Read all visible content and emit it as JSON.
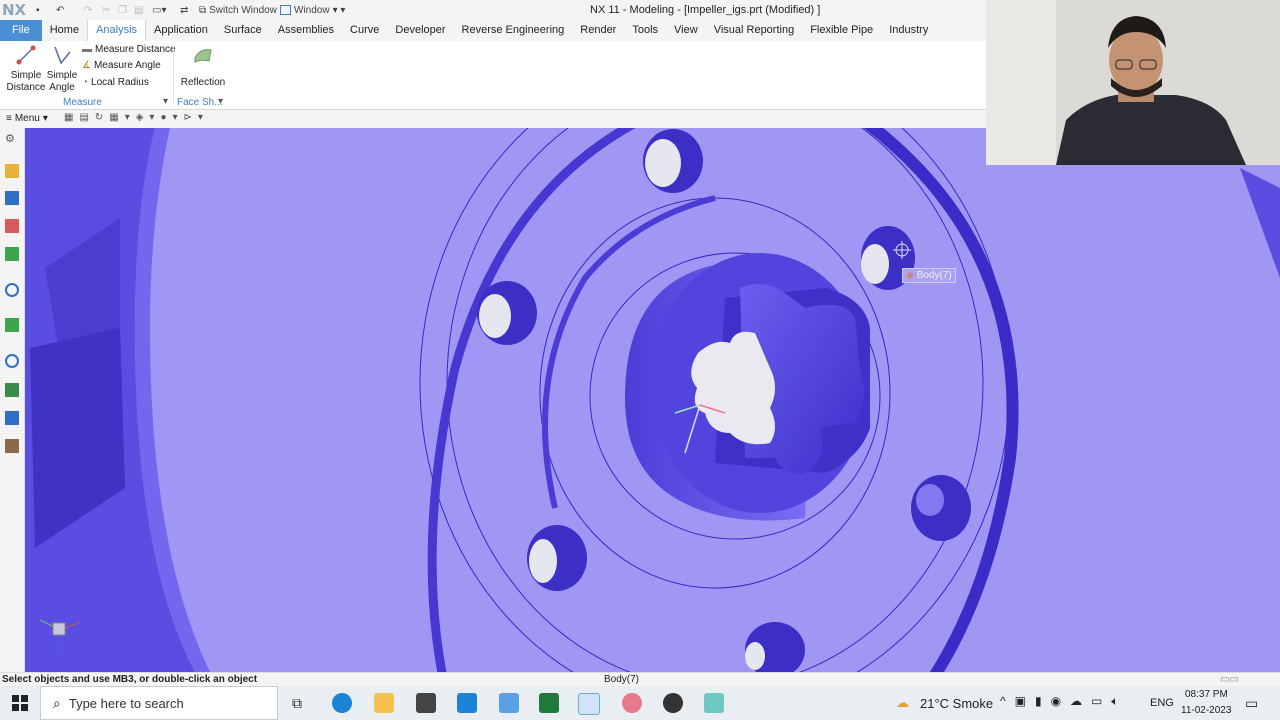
{
  "titlebar": {
    "logo": "NX",
    "switch_window": "Switch Window",
    "window": "Window",
    "title": "NX 11 - Modeling - [Impeller_igs.prt (Modified) ]"
  },
  "tabs": [
    "File",
    "Home",
    "Analysis",
    "Application",
    "Surface",
    "Assemblies",
    "Curve",
    "Developer",
    "Reverse Engineering",
    "Render",
    "Tools",
    "View",
    "Visual Reporting",
    "Flexible Pipe",
    "Industry"
  ],
  "ribbon": {
    "simple_distance": "Simple\nDistance",
    "simple_distance_l1": "Simple",
    "simple_distance_l2": "Distance",
    "simple_angle_l1": "Simple",
    "simple_angle_l2": "Angle",
    "measure_distance": "Measure Distance",
    "measure_angle": "Measure Angle",
    "local_radius": "Local Radius",
    "group_measure": "Measure",
    "reflection": "Reflection",
    "group_face_shape": "Face Sh..."
  },
  "cmdbar": {
    "menu": "Menu"
  },
  "viewport": {
    "tooltip": "Body(7)",
    "model_color": "#5346d6",
    "background": "#a097f5"
  },
  "status": {
    "prompt": "Select objects and use MB3, or double-click an object",
    "selection": "Body(7)"
  },
  "taskbar": {
    "search_placeholder": "Type here to search",
    "weather": "21°C  Smoke",
    "lang": "ENG",
    "time": "08:37 PM",
    "date": "11-02-2023"
  }
}
